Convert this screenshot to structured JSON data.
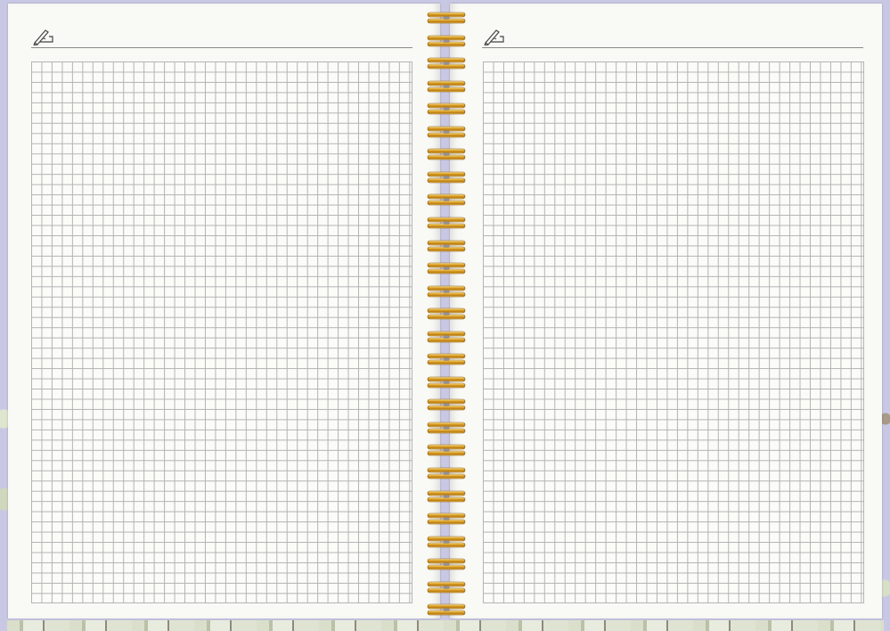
{
  "notebook": {
    "type": "spiral-bound graph-paper notebook, open two-page spread",
    "colors": {
      "cover": "#c9c8e4",
      "paper": "#f9f9f6",
      "grid_line": "#b4b4b4",
      "ring_gold": "#e3a92b"
    },
    "left_page": {
      "header_icon": "pen-writing-icon"
    },
    "right_page": {
      "header_icon": "pen-writing-icon"
    },
    "spiral": {
      "ring_count": 27
    }
  }
}
